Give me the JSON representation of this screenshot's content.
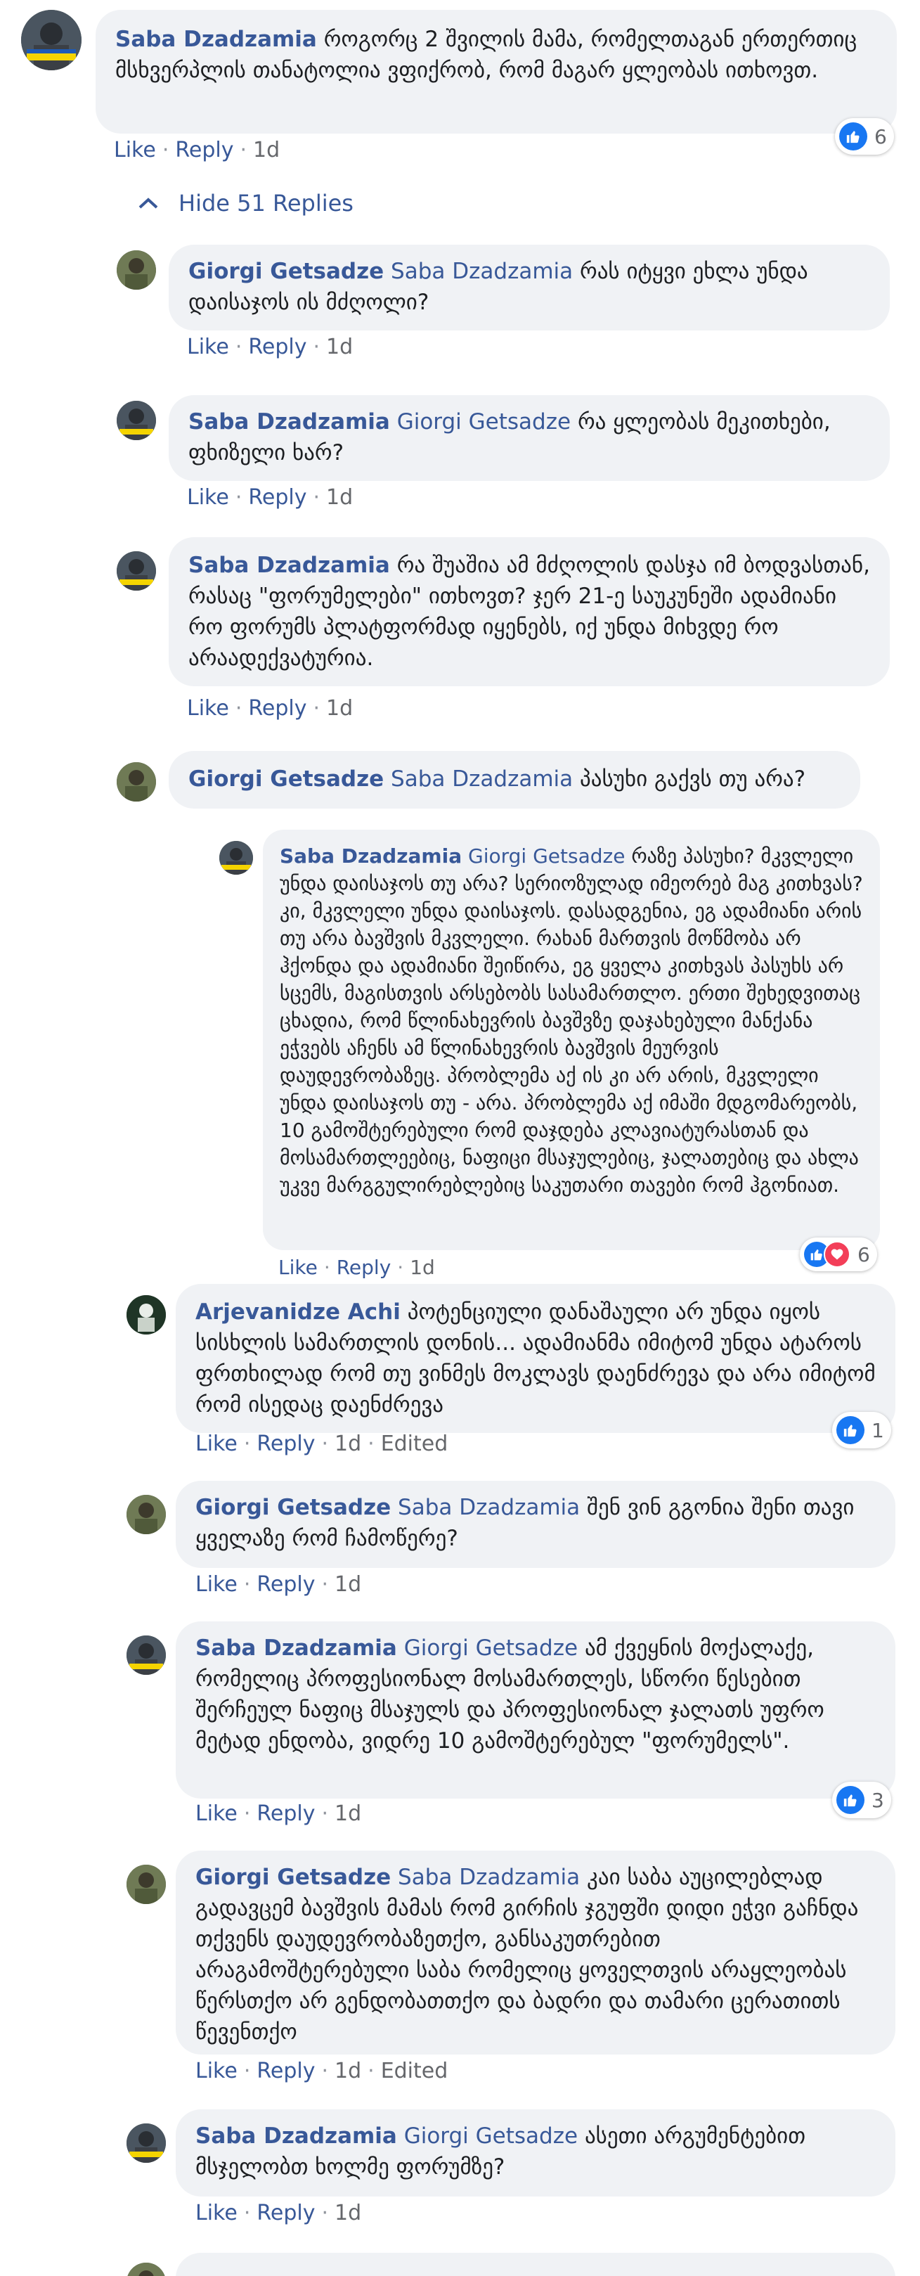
{
  "actions": {
    "like": "Like",
    "reply": "Reply",
    "edited": "Edited",
    "dot": "·"
  },
  "hide_replies": "Hide 51 Replies",
  "comments": [
    {
      "author": "Saba Dzadzamia",
      "tag": "",
      "text": "როგორც 2 შვილის მამა, რომელთაგან ერთერთიც მსხვერპლის თანატოლია ვფიქრობ, რომ მაგარ ყლეობას ითხოვთ.",
      "time": "1d",
      "reactions": "6",
      "avatar_label": "UKRAINE"
    },
    {
      "author": "Giorgi Getsadze",
      "tag": "Saba Dzadzamia",
      "text": "რას იტყვი ეხლა უნდა დაისაჯოს ის მძღოლი?",
      "time": "1d"
    },
    {
      "author": "Saba Dzadzamia",
      "tag": "Giorgi Getsadze",
      "text": "რა ყლეობას მეკითხები, ფხიზელი ხარ?",
      "time": "1d"
    },
    {
      "author": "Saba Dzadzamia",
      "tag": "",
      "text": "რა შუაშია ამ მძღოლის დასჯა იმ ბოდვასთან, რასაც \"ფორუმელები\" ითხოვთ? ჯერ 21-ე საუკუნეში ადამიანი რო ფორუმს პლატფორმად იყენებს, იქ უნდა მიხვდე რო არაადექვატურია.",
      "time": "1d"
    },
    {
      "author": "Giorgi Getsadze",
      "tag": "Saba Dzadzamia",
      "text": "პასუხი გაქვს თუ არა?",
      "time": ""
    },
    {
      "author": "Saba Dzadzamia",
      "tag": "Giorgi Getsadze",
      "text": "რაზე პასუხი? მკვლელი უნდა დაისაჯოს თუ არა? სერიოზულად იმეორებ მაგ კითხვას? კი, მკვლელი უნდა დაისაჯოს. დასადგენია, ეგ ადამიანი არის თუ არა ბავშვის მკვლელი. რახან მართვის მოწმობა არ ჰქონდა და ადამიანი შეიწირა, ეგ ყველა კითხვას პასუხს არ სცემს, მაგისთვის არსებობს სასამართლო. ერთი შეხედვითაც ცხადია, რომ წლინახევრის ბავშვზე დაჯახებული მანქანა ეჭვებს აჩენს ამ წლინახევრის ბავშვის მეურვის დაუდევრობაზეც. პრობლემა აქ ის კი არ არის, მკვლელი უნდა დაისაჯოს თუ - არა. პრობლემა აქ იმაში მდგომარეობს, 10 გამოშტერებული რომ დაჯდება კლავიატურასთან და მოსამართლეებიც, ნაფიცი მსაჯულებიც, ჯალათებიც და ახლა უკვე მარგგულირებლებიც საკუთარი თავები რომ ჰგონიათ.",
      "time": "1d",
      "reactions": "6"
    },
    {
      "author": "Arjevanidze Achi",
      "tag": "",
      "text": "პოტენციული დანაშაული არ უნდა იყოს სისხლის სამართლის დონის... ადამიანმა იმიტომ უნდა ატაროს ფრთხილად რომ თუ ვინმეს მოკლავს დაენძრევა და არა იმიტომ რომ ისედაც დაენძრევა",
      "time": "1d",
      "edited": true,
      "reactions": "1"
    },
    {
      "author": "Giorgi Getsadze",
      "tag": "Saba Dzadzamia",
      "text": "შენ ვინ გგონია შენი თავი ყველაზე რომ ჩამოწერე?",
      "time": "1d"
    },
    {
      "author": "Saba Dzadzamia",
      "tag": "Giorgi Getsadze",
      "text": "ამ ქვეყნის მოქალაქე, რომელიც პროფესიონალ მოსამართლეს, სწორი წესებით შერჩეულ ნაფიც მსაჯულს და პროფესიონალ ჯალათს უფრო მეტად ენდობა, ვიდრე 10 გამოშტერებულ \"ფორუმელს\".",
      "time": "1d",
      "reactions": "3"
    },
    {
      "author": "Giorgi Getsadze",
      "tag": "Saba Dzadzamia",
      "text": "კაი საბა აუცილებლად გადავცემ ბავშვის მამას რომ გირჩის ჯგუფში დიდი ეჭვი გაჩნდა თქვენს დაუდევრობაზეთქო, განსაკუთრებით არაგამოშტერებული საბა რომელიც ყოველთვის არაყლეობას წერსთქო არ გენდობათთქო და ბადრი და თამარი ცერათითს წევენთქო",
      "time": "1d",
      "edited": true
    },
    {
      "author": "Saba Dzadzamia",
      "tag": "Giorgi Getsadze",
      "text": "ასეთი არგუმენტებით მსჯელობთ ხოლმე ფორუმზე?",
      "time": "1d"
    }
  ]
}
